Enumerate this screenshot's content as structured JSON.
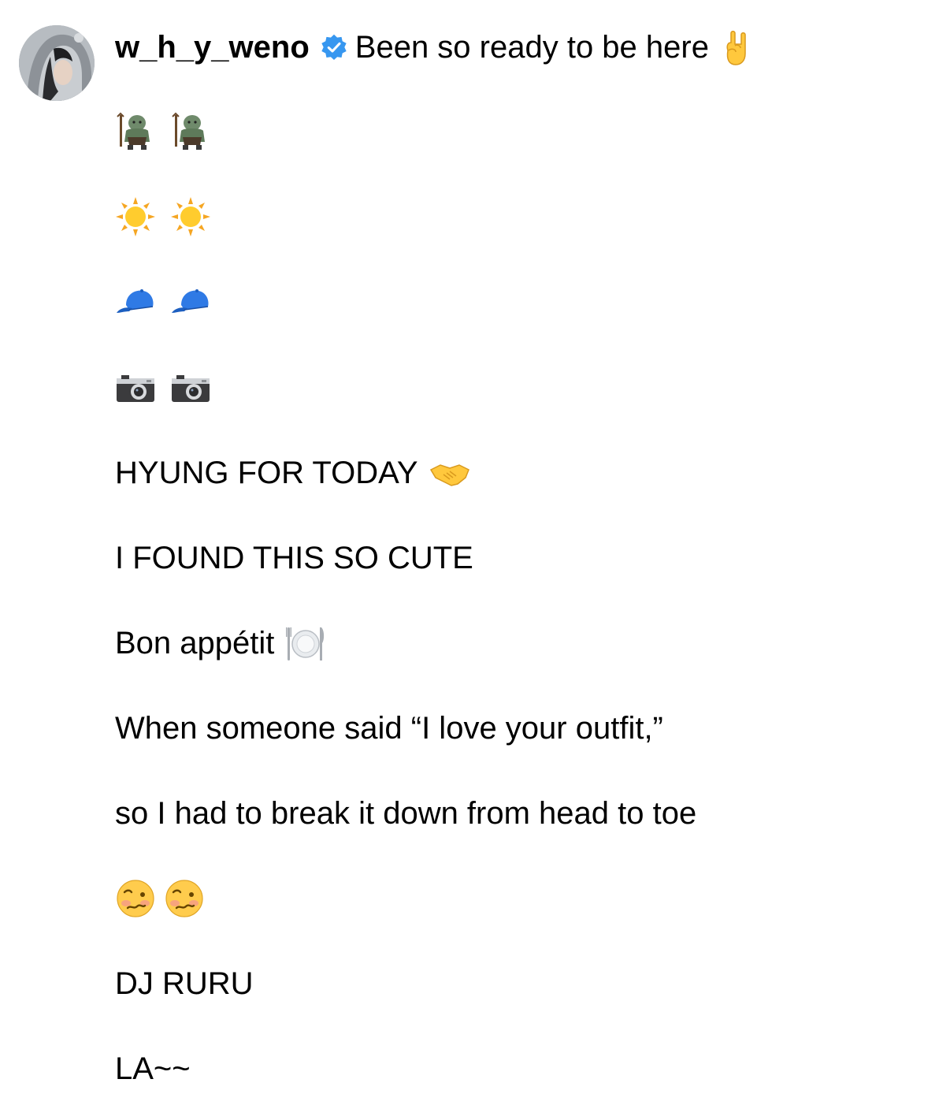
{
  "post": {
    "username": "w_h_y_weno",
    "verified": true,
    "first_line": "Been so ready to be here",
    "first_line_emoji": "sign-of-the-horns-emoji",
    "lines": {
      "troll_emojis": [
        "troll-emoji",
        "troll-emoji"
      ],
      "sun_emojis": [
        "sun-emoji",
        "sun-emoji"
      ],
      "cap_emojis": [
        "billed-cap-emoji",
        "billed-cap-emoji"
      ],
      "camera_emojis": [
        "camera-emoji",
        "camera-emoji"
      ],
      "hyung": "HYUNG FOR TODAY",
      "hyung_emoji": "handshake-emoji",
      "found": "I FOUND THIS SO CUTE",
      "bon": "Bon appétit",
      "bon_emoji": "fork-knife-plate-emoji",
      "when": "When someone said “I love your outfit,”",
      "so": "so I had to break it down from head to toe",
      "woozy_emojis": [
        "woozy-face-emoji",
        "woozy-face-emoji"
      ],
      "dj": "DJ RURU",
      "la": "LA~~"
    }
  },
  "colors": {
    "verified_blue": "#3797f0",
    "text": "#000000",
    "background": "#ffffff"
  }
}
